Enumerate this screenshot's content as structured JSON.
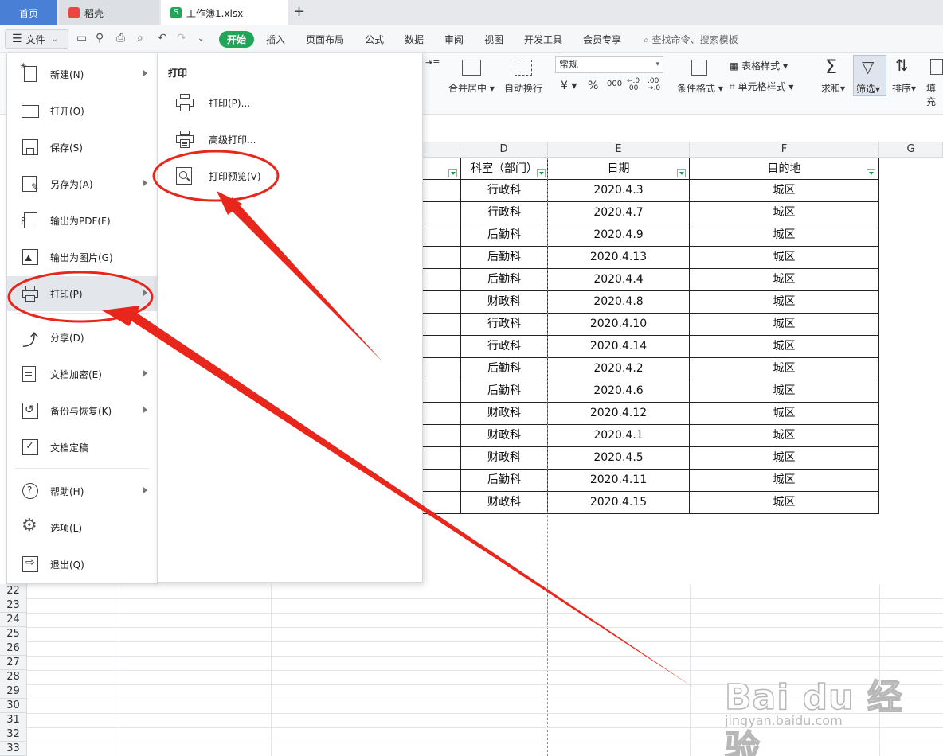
{
  "tabs": {
    "home": "首页",
    "daoke": "稻壳",
    "workbook": "工作簿1.xlsx"
  },
  "menubar": {
    "file": "文件",
    "start": "开始",
    "items": [
      "插入",
      "页面布局",
      "公式",
      "数据",
      "审阅",
      "视图",
      "开发工具",
      "会员专享"
    ],
    "search": "查找命令、搜索模板"
  },
  "ribbon": {
    "merge_center": "合并居中",
    "auto_wrap": "自动换行",
    "number_format": "常规",
    "cond_format": "条件格式",
    "table_style": "表格样式",
    "cell_style": "单元格样式",
    "sum": "求和",
    "filter": "筛选",
    "sort": "排序",
    "fill": "填充",
    "currency": "¥",
    "percent": "%",
    "thousands": "000"
  },
  "file_menu": {
    "items": [
      {
        "label": "新建(N)",
        "arrow": true
      },
      {
        "label": "打开(O)",
        "arrow": false
      },
      {
        "label": "保存(S)",
        "arrow": false
      },
      {
        "label": "另存为(A)",
        "arrow": true
      },
      {
        "label": "输出为PDF(F)",
        "arrow": false
      },
      {
        "label": "输出为图片(G)",
        "arrow": false
      },
      {
        "label": "打印(P)",
        "arrow": true
      },
      {
        "label": "分享(D)",
        "arrow": false
      },
      {
        "label": "文档加密(E)",
        "arrow": true
      },
      {
        "label": "备份与恢复(K)",
        "arrow": true
      },
      {
        "label": "文档定稿",
        "arrow": false
      },
      {
        "label": "帮助(H)",
        "arrow": true
      },
      {
        "label": "选项(L)",
        "arrow": false
      },
      {
        "label": "退出(Q)",
        "arrow": false
      }
    ]
  },
  "print_submenu": {
    "title": "打印",
    "items": [
      "打印(P)...",
      "高级打印...",
      "打印预览(V)"
    ]
  },
  "sheet": {
    "columns": [
      "D",
      "E",
      "F",
      "G"
    ],
    "headers": {
      "D": "科室（部门）",
      "E": "日期",
      "F": "目的地"
    },
    "rows": [
      [
        "行政科",
        "2020.4.3",
        "城区"
      ],
      [
        "行政科",
        "2020.4.7",
        "城区"
      ],
      [
        "后勤科",
        "2020.4.9",
        "城区"
      ],
      [
        "后勤科",
        "2020.4.13",
        "城区"
      ],
      [
        "后勤科",
        "2020.4.4",
        "城区"
      ],
      [
        "财政科",
        "2020.4.8",
        "城区"
      ],
      [
        "行政科",
        "2020.4.10",
        "城区"
      ],
      [
        "行政科",
        "2020.4.14",
        "城区"
      ],
      [
        "后勤科",
        "2020.4.2",
        "城区"
      ],
      [
        "后勤科",
        "2020.4.6",
        "城区"
      ],
      [
        "财政科",
        "2020.4.12",
        "城区"
      ],
      [
        "财政科",
        "2020.4.1",
        "城区"
      ],
      [
        "财政科",
        "2020.4.5",
        "城区"
      ],
      [
        "后勤科",
        "2020.4.11",
        "城区"
      ],
      [
        "财政科",
        "2020.4.15",
        "城区"
      ]
    ],
    "row_numbers": [
      "22",
      "23",
      "24",
      "25",
      "26",
      "27",
      "28",
      "29",
      "30",
      "31",
      "32",
      "33"
    ]
  },
  "watermark": {
    "text": "Bai du 经验",
    "url": "jingyan.baidu.com"
  },
  "colors": {
    "accent_blue": "#4a7fd6",
    "start_green": "#22a559",
    "annotation_red": "#e8261c"
  }
}
